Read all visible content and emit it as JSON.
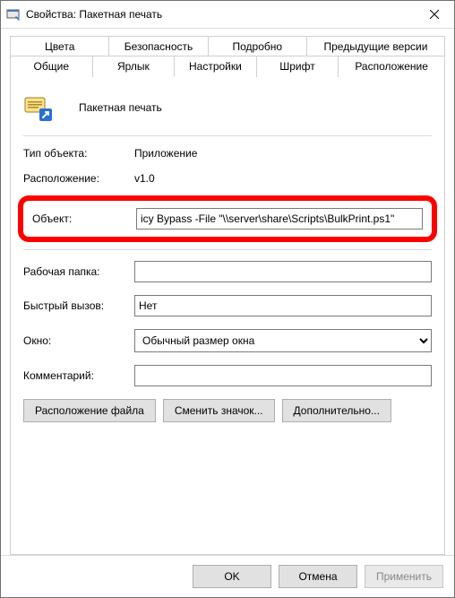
{
  "window": {
    "title": "Свойства: Пакетная печать"
  },
  "tabs": {
    "row1": [
      {
        "id": "colors",
        "label": "Цвета"
      },
      {
        "id": "security",
        "label": "Безопасность"
      },
      {
        "id": "details",
        "label": "Подробно"
      },
      {
        "id": "prev",
        "label": "Предыдущие версии"
      }
    ],
    "row2": [
      {
        "id": "general",
        "label": "Общие"
      },
      {
        "id": "shortcut",
        "label": "Ярлык",
        "active": true
      },
      {
        "id": "settings",
        "label": "Настройки"
      },
      {
        "id": "font",
        "label": "Шрифт"
      },
      {
        "id": "layout",
        "label": "Расположение"
      }
    ]
  },
  "header": {
    "name": "Пакетная печать"
  },
  "fields": {
    "type_label": "Тип объекта:",
    "type_value": "Приложение",
    "location_label": "Расположение:",
    "location_value": "v1.0",
    "target_label": "Объект:",
    "target_value": "icy Bypass -File \"\\\\server\\share\\Scripts\\BulkPrint.ps1\"",
    "startin_label": "Рабочая папка:",
    "startin_value": "",
    "hotkey_label": "Быстрый вызов:",
    "hotkey_value": "Нет",
    "run_label": "Окно:",
    "run_value": "Обычный размер окна",
    "comment_label": "Комментарий:",
    "comment_value": ""
  },
  "buttons": {
    "open_location": "Расположение файла",
    "change_icon": "Сменить значок...",
    "advanced": "Дополнительно..."
  },
  "footer": {
    "ok": "OK",
    "cancel": "Отмена",
    "apply": "Применить"
  }
}
